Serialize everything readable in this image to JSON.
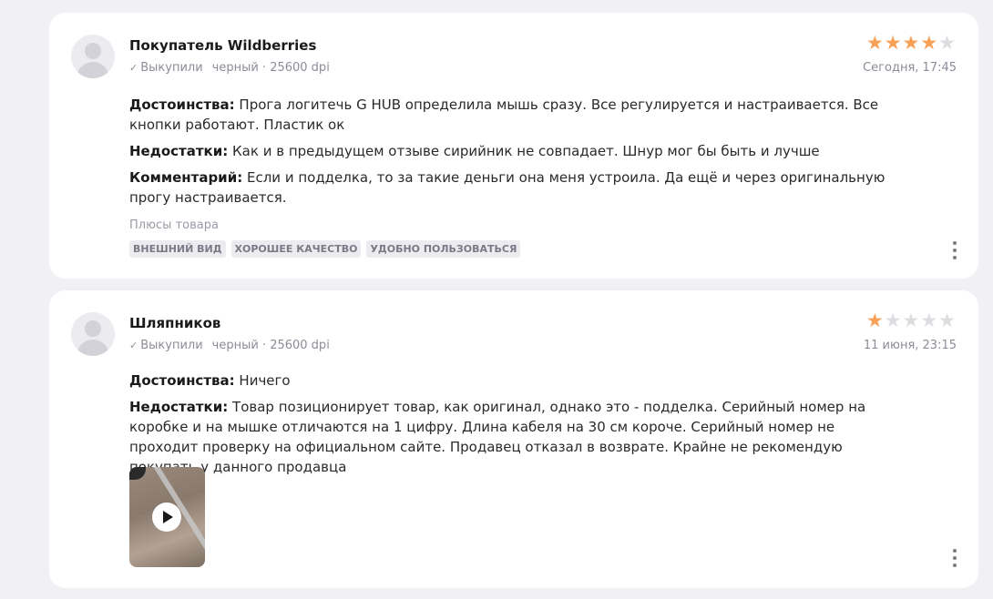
{
  "colors": {
    "star_on": "#f8a055",
    "star_off": "#dcdce1",
    "background": "#f0f0f5",
    "card": "#ffffff"
  },
  "reviews": [
    {
      "author": "Покупатель Wildberries",
      "purchased": "Выкупили",
      "variant": "черный · 25600 dpi",
      "rating": 4,
      "date": "Сегодня, 17:45",
      "pros_label": "Достоинства:",
      "pros": "Прога логитечь G HUB определила мышь сразу. Все регулируется и настраивается. Все кнопки работают. Пластик ок",
      "cons_label": "Недостатки:",
      "cons": "Как и в предыдущем отзыве сирийник не совпадает. Шнур мог бы быть и лучше",
      "comment_label": "Комментарий:",
      "comment": "Если и подделка, то за такие деньги она меня устроила. Да ещё и через оригинальную прогу настраивается.",
      "plus_title": "Плюсы товара",
      "tags": [
        "Внешний вид",
        "Хорошее качество",
        "Удобно пользоваться"
      ],
      "icons": {
        "avatar": "user-avatar-icon",
        "check": "check-icon",
        "more": "more-vertical-icon"
      }
    },
    {
      "author": "Шляпников",
      "purchased": "Выкупили",
      "variant": "черный · 25600 dpi",
      "rating": 1,
      "date": "11 июня, 23:15",
      "pros_label": "Достоинства:",
      "pros": "Ничего",
      "cons_label": "Недостатки:",
      "cons": "Товар позиционирует товар, как оригинал, однако это - подделка. Серийный номер на коробке и на мышке отличаются на 1 цифру. Длина кабеля на 30 см короче. Серийный номер не проходит проверку на официальном сайте. Продавец отказал в возврате. Крайне не рекомендую покупать у данного продавца",
      "media": {
        "type": "video",
        "icon": "play-icon"
      },
      "icons": {
        "avatar": "user-avatar-icon",
        "check": "check-icon",
        "more": "more-vertical-icon"
      }
    }
  ]
}
